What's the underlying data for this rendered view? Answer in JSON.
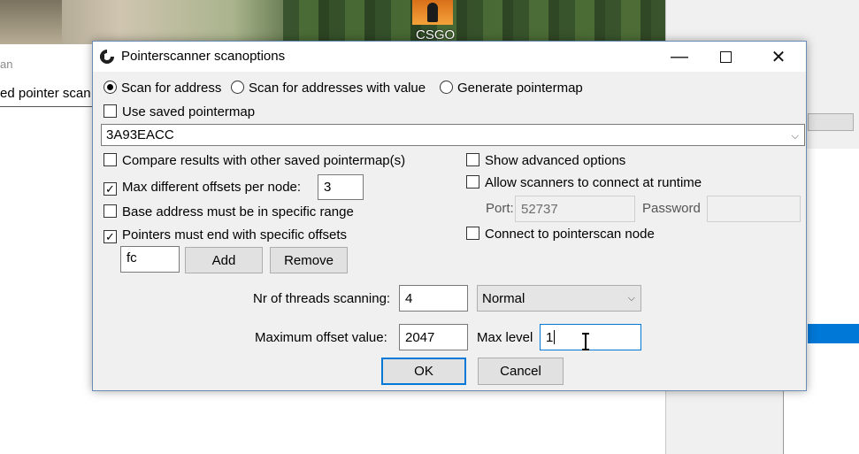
{
  "background": {
    "desktop_icon_label": "CSGO",
    "left_text_faded": "an",
    "left_text_partial": "ed pointer scan"
  },
  "dialog": {
    "title": "Pointerscanner scanoptions",
    "radio": {
      "scan_for_address": "Scan for address",
      "scan_with_value": "Scan for addresses with value",
      "generate_pointermap": "Generate pointermap"
    },
    "use_saved_pointermap": "Use saved pointermap",
    "address_value": "3A93EACC",
    "compare_results": "Compare results with other saved pointermap(s)",
    "max_offsets_label": "Max different offsets per node:",
    "max_offsets_value": "3",
    "base_address_range": "Base address must be in specific range",
    "pointers_end_offsets": "Pointers must end with specific offsets",
    "offset_value": "fc",
    "add_button": "Add",
    "remove_button": "Remove",
    "show_advanced": "Show advanced options",
    "allow_scanners": "Allow scanners to connect at runtime",
    "port_label": "Port:",
    "port_value": "52737",
    "password_label": "Password",
    "connect_node": "Connect to pointerscan node",
    "threads_label": "Nr of threads scanning:",
    "threads_value": "4",
    "priority_value": "Normal",
    "max_offset_label": "Maximum offset value:",
    "max_offset_value": "2047",
    "max_level_label": "Max level",
    "max_level_value": "1",
    "ok_button": "OK",
    "cancel_button": "Cancel"
  },
  "checks": {
    "max_offsets": true,
    "pointers_end": true
  },
  "colors": {
    "accent": "#0078d7",
    "dialog_bg": "#f0f0f0"
  }
}
